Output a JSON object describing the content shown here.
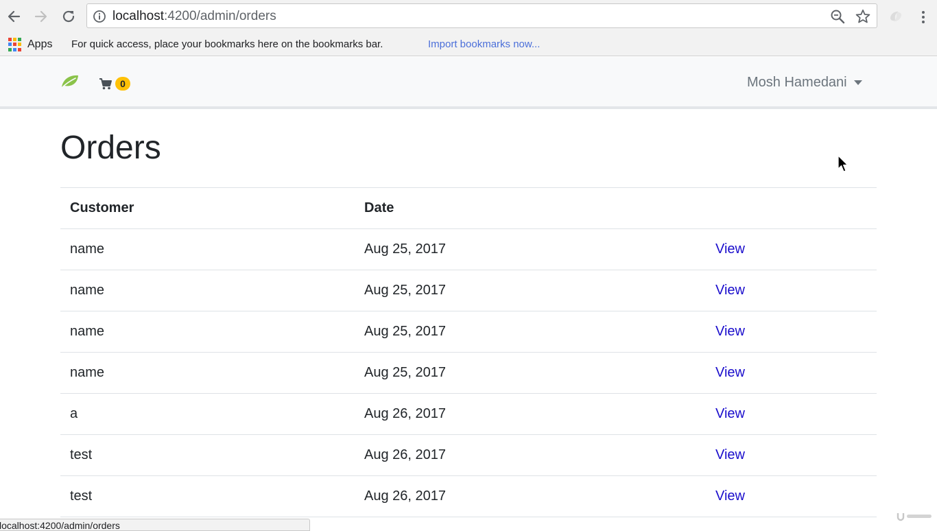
{
  "browser": {
    "url_host": "localhost",
    "url_path": ":4200/admin/orders",
    "icons": {
      "back": "arrow-left-icon",
      "forward": "arrow-right-icon",
      "reload": "reload-icon",
      "info": "info-icon",
      "zoom": "zoom-icon",
      "bookmark": "star-icon",
      "menu": "more-vert-icon"
    }
  },
  "bookmarks_bar": {
    "apps_label": "Apps",
    "hint": "For quick access, place your bookmarks here on the bookmarks bar.",
    "import_link": "Import bookmarks now..."
  },
  "navbar": {
    "cart_count": "0",
    "user_name": "Mosh Hamedani",
    "brand_color": "#8bc34a",
    "badge_color": "#ffc107"
  },
  "main": {
    "title": "Orders",
    "table": {
      "headers": [
        "Customer",
        "Date",
        ""
      ],
      "rows": [
        {
          "customer": "name",
          "date": "Aug 25, 2017",
          "action": "View"
        },
        {
          "customer": "name",
          "date": "Aug 25, 2017",
          "action": "View"
        },
        {
          "customer": "name",
          "date": "Aug 25, 2017",
          "action": "View"
        },
        {
          "customer": "name",
          "date": "Aug 25, 2017",
          "action": "View"
        },
        {
          "customer": "a",
          "date": "Aug 26, 2017",
          "action": "View"
        },
        {
          "customer": "test",
          "date": "Aug 26, 2017",
          "action": "View"
        },
        {
          "customer": "test",
          "date": "Aug 26, 2017",
          "action": "View"
        }
      ]
    }
  },
  "status_bar": {
    "text": "localhost:4200/admin/orders"
  },
  "colors": {
    "link": "#1a0dcc",
    "text": "#212529",
    "muted": "#6c757d"
  }
}
